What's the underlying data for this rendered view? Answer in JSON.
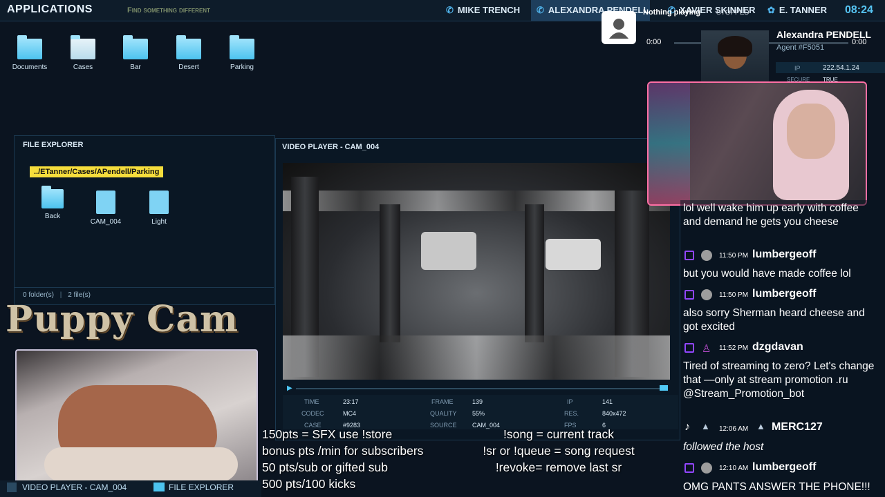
{
  "topbar": {
    "title": "APPLICATIONS",
    "find_text": "Find something different",
    "contacts": [
      "MIKE TRENCH",
      "ALEXANDRA PENDELL",
      "XAVIER SKINNER",
      "E. TANNER"
    ],
    "clock": "08:24",
    "now_playing": "Nothing playing",
    "stopped": "STOPPED"
  },
  "media": {
    "time_left": "0:00",
    "time_right": "0:00"
  },
  "contact_card": {
    "name": "Alexandra PENDELL",
    "agent": "Agent #F5051",
    "ip_label": "IP",
    "ip_value": "222.54.1.24",
    "secure_label": "SECURE",
    "secure_value": "TRUE"
  },
  "desktop_icons": [
    "Documents",
    "Cases",
    "Bar",
    "Desert",
    "Parking"
  ],
  "file_explorer": {
    "title": "FILE EXPLORER",
    "path": "../ETanner/Cases/APendell/Parking",
    "items": [
      "Back",
      "CAM_004",
      "Light"
    ],
    "folders": "0 folder(s)",
    "files": "2 file(s)"
  },
  "video_player": {
    "title": "VIDEO PLAYER - CAM_004",
    "meta": {
      "time_label": "TIME",
      "time": "23:17",
      "frame_label": "FRAME",
      "frame": "139",
      "ip_label": "IP",
      "ip": "141",
      "codec_label": "CODEC",
      "codec": "MC4",
      "quality_label": "QUALITY",
      "quality": "55%",
      "res_label": "RES.",
      "res": "840x472",
      "case_label": "CASE",
      "case": "#9283",
      "source_label": "SOURCE",
      "source": "CAM_004",
      "fps_label": "FPS",
      "fps": "6"
    }
  },
  "puppy_cam": {
    "title": "Puppy Cam"
  },
  "commands": {
    "left": [
      "150pts = SFX use !store",
      "bonus pts /min for subscribers",
      "50 pts/sub or gifted sub",
      "500 pts/100 kicks"
    ],
    "right": [
      "!song = current track",
      "!sr or !queue = song request",
      "!revoke= remove last sr"
    ]
  },
  "chat": {
    "messages": [
      {
        "text": "lol well wake him up early with coffee and demand he gets you cheese"
      },
      {
        "time": "11:50 PM",
        "user": "lumbergeoff",
        "text": "but you would have made coffee lol"
      },
      {
        "time": "11:50 PM",
        "user": "lumbergeoff",
        "text": "also sorry Sherman heard cheese and got excited"
      },
      {
        "time": "11:52 PM",
        "user": "dzgdavan",
        "text": "Tired of streaming to zero? Let's change that —only at stream promotion .ru @Stream_Promotion_bot"
      },
      {
        "time": "12:06 AM",
        "user": "MERC127",
        "text": "followed the host"
      },
      {
        "time": "12:10 AM",
        "user": "lumbergeoff",
        "text": "OMG PANTS ANSWER THE PHONE!!!"
      }
    ]
  },
  "taskbar": {
    "items": [
      "VIDEO PLAYER - CAM_004",
      "FILE EXPLORER"
    ]
  }
}
